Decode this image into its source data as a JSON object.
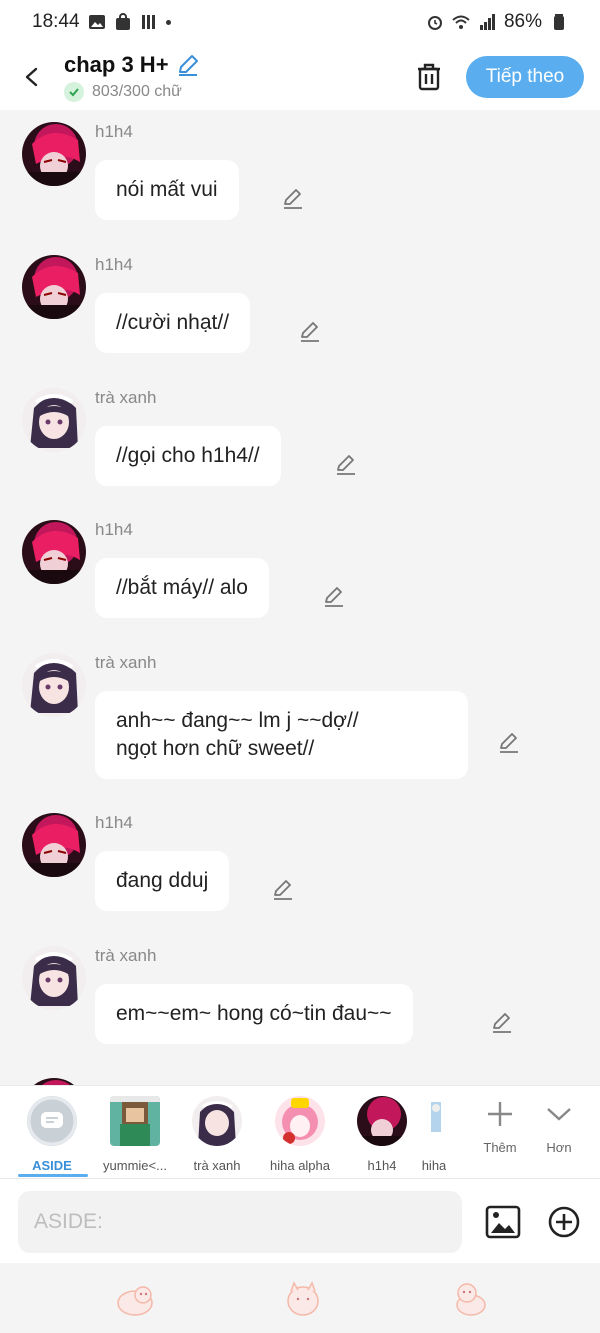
{
  "status_bar": {
    "time": "18:44",
    "battery": "86%"
  },
  "header": {
    "title": "chap 3 H+",
    "word_count": "803/300 chữ",
    "next_label": "Tiếp theo"
  },
  "messages": [
    {
      "sender": "h1h4",
      "text": "nói mất vui"
    },
    {
      "sender": "h1h4",
      "text": "//cười nhạt//"
    },
    {
      "sender": "trà xanh",
      "text": "//gọi cho h1h4//"
    },
    {
      "sender": "h1h4",
      "text": "//bắt máy// alo"
    },
    {
      "sender": "trà xanh",
      "text": "anh~~ đang~~ lm j ~~dợ//\nngọt hơn chữ sweet//"
    },
    {
      "sender": "h1h4",
      "text": "đang dduj"
    },
    {
      "sender": "trà xanh",
      "text": "em~~em~ hong có~tin đau~~"
    }
  ],
  "characters": [
    {
      "label": "ASIDE"
    },
    {
      "label": "yummie<..."
    },
    {
      "label": "trà xanh"
    },
    {
      "label": "hiha alpha"
    },
    {
      "label": "h1h4"
    },
    {
      "label": "hiha"
    }
  ],
  "actions": {
    "add_label": "Thêm",
    "more_label": "Hơn"
  },
  "input": {
    "placeholder": "ASIDE:"
  },
  "colors": {
    "accent": "#5aaeef",
    "h1h4_avatar": "#c2185b",
    "tra_xanh_avatar": "#4a3a5a"
  }
}
